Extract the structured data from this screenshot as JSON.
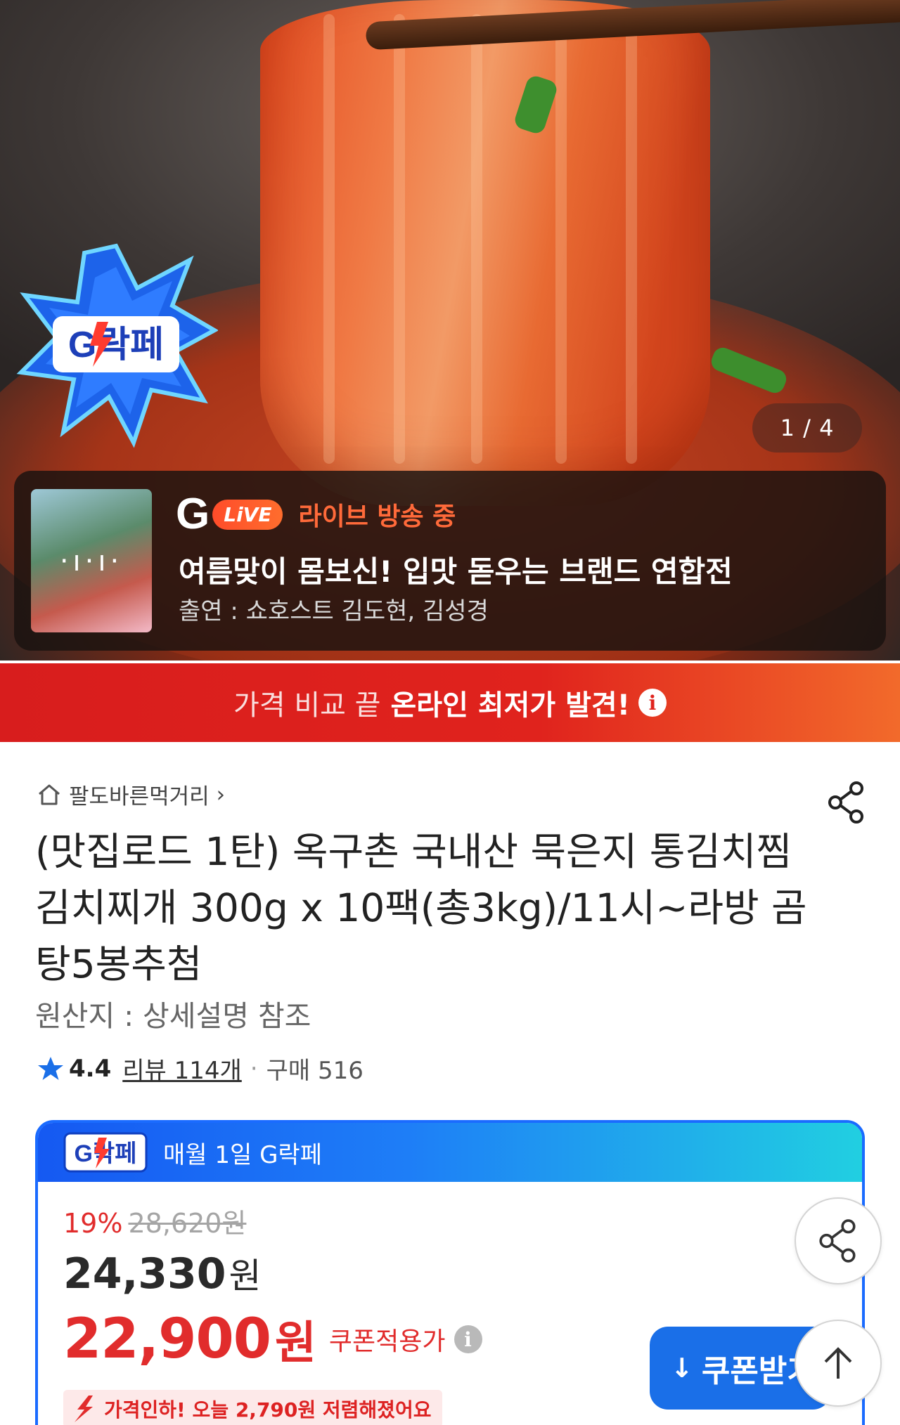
{
  "hero": {
    "slide_counter": "1 / 4",
    "promo_logo_text": "G락페"
  },
  "live": {
    "g_letter": "G",
    "pill": "LiVE",
    "status": "라이브 방송 중",
    "title": "여름맞이 몸보신! 입맛 돋우는 브랜드 연합전",
    "cast": "출연 : 쇼호스트 김도현, 김성경",
    "thumb_dots": "·ı·ı·"
  },
  "price_banner": {
    "light": "가격 비교 끝",
    "bold": "온라인 최저가 발견!",
    "info": "i"
  },
  "product": {
    "breadcrumb": "팔도바른먹거리",
    "breadcrumb_chevron": "›",
    "title": "(맛집로드 1탄) 옥구촌 국내산 묵은지 통김치찜 김치찌개 300g x 10팩(총3kg)/11시~라방 곰탕5봉추첨",
    "origin": "원산지 : 상세설명 참조",
    "rating": "4.4",
    "reviews": "리뷰 114개",
    "separator": "·",
    "purchases": "구매 516"
  },
  "price_card": {
    "header_text": "매월 1일 G락페",
    "discount_pct": "19%",
    "original_price": "28,620원",
    "sale_price": "24,330",
    "sale_unit": "원",
    "coupon_price": "22,900",
    "coupon_unit": "원",
    "coupon_label": "쿠폰적용가",
    "info": "i",
    "drop_text": "가격인하! 오늘 2,790원 저렴해졌어요"
  },
  "coupon_button": {
    "icon": "↓",
    "label": "쿠폰받기"
  },
  "colors": {
    "accent_red": "#e12c2c",
    "accent_blue": "#1a6fe8",
    "live_orange": "#ff6a3a"
  },
  "icons": [
    "home-icon",
    "share-icon",
    "star-icon",
    "info-icon",
    "download-icon",
    "arrow-up-icon",
    "price-drop-arrow-icon"
  ]
}
